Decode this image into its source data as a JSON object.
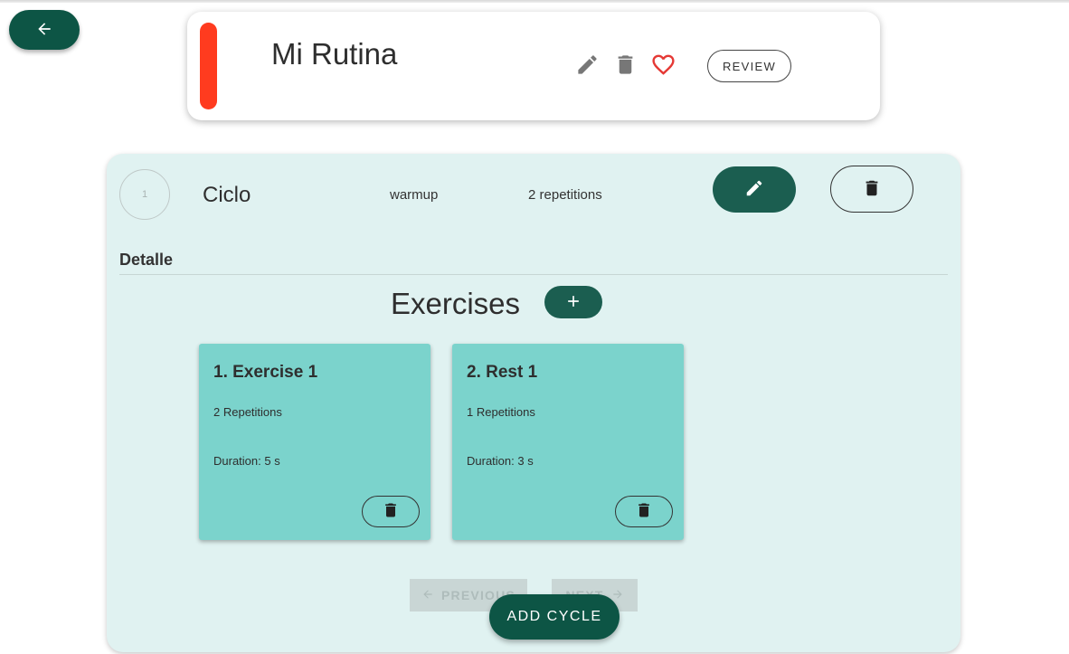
{
  "routine": {
    "title": "Mi Rutina",
    "color": "#ff3b1f",
    "review_label": "REVIEW",
    "icons": [
      "edit-icon",
      "delete-icon",
      "heart-outline-icon"
    ]
  },
  "cycle": {
    "number": "1",
    "name": "Ciclo",
    "type": "warmup",
    "repetitions": "2 repetitions",
    "detail_label": "Detalle"
  },
  "exercises": {
    "title": "Exercises",
    "items": [
      {
        "title": "1. Exercise 1",
        "repetitions": "2 Repetitions",
        "duration": "Duration: 5 s"
      },
      {
        "title": "2. Rest 1",
        "repetitions": "1 Repetitions",
        "duration": "Duration: 3 s"
      }
    ]
  },
  "pagination": {
    "previous_label": "PREVIOUS",
    "next_label": "NEXT"
  },
  "actions": {
    "add_cycle_label": "ADD CYCLE"
  },
  "colors": {
    "primary_dark": "#0d5545",
    "primary": "#1b5e50",
    "panel_bg": "#e0f2f1",
    "card_bg": "#7bd3cc",
    "favorite": "#e53935"
  }
}
